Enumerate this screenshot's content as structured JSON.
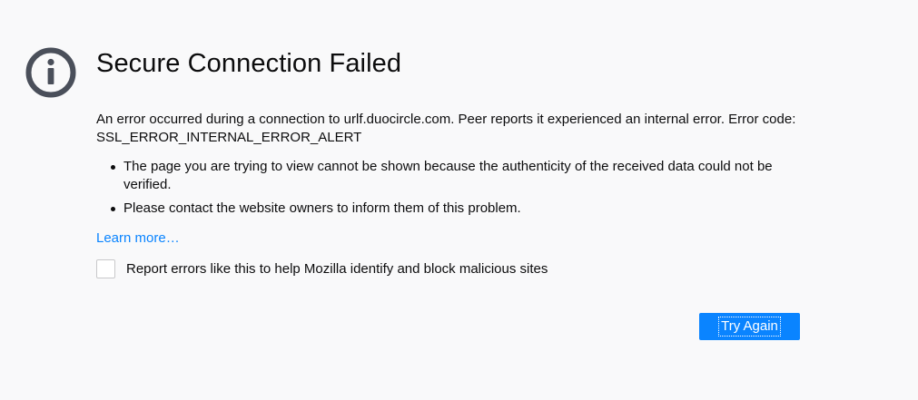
{
  "error": {
    "icon": "info-icon",
    "title": "Secure Connection Failed",
    "description": "An error occurred during a connection to urlf.duocircle.com. Peer reports it experienced an internal error. Error code: SSL_ERROR_INTERNAL_ERROR_ALERT",
    "bullets": [
      "The page you are trying to view cannot be shown because the authenticity of the received data could not be verified.",
      "Please contact the website owners to inform them of this problem."
    ],
    "learn_more": "Learn more…",
    "report_checkbox_label": "Report errors like this to help Mozilla identify and block malicious sites",
    "report_checked": false,
    "try_again_label": "Try Again"
  },
  "colors": {
    "background": "#f9f9fa",
    "icon": "#4a4f5a",
    "link": "#0a84ff",
    "button": "#0a84ff",
    "text": "#0c0c0d"
  }
}
